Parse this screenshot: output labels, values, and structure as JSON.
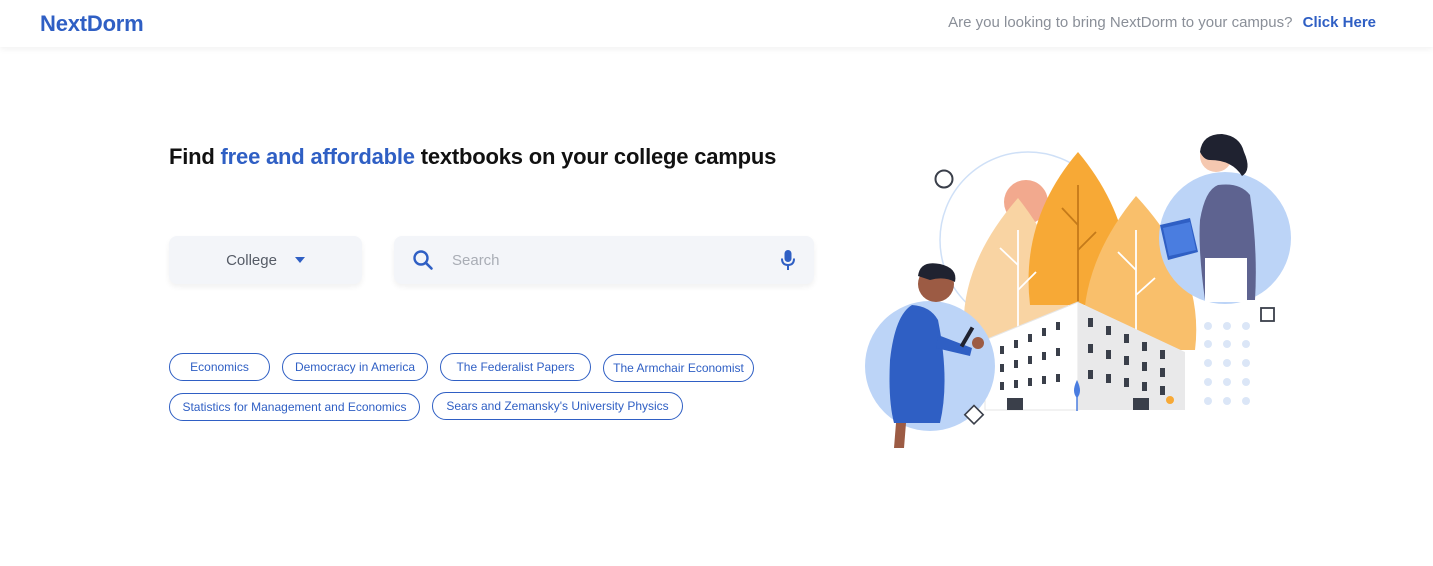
{
  "header": {
    "logo": "NextDorm",
    "promo_text": "Are you looking to bring NextDorm to your campus?",
    "promo_link": "Click Here"
  },
  "hero": {
    "headline_pre": "Find ",
    "headline_highlight": "free and affordable",
    "headline_post": " textbooks on your college campus"
  },
  "college_select": {
    "label": "College",
    "icon": "caret-down-icon"
  },
  "search": {
    "placeholder": "Search",
    "search_icon": "search-icon",
    "mic_icon": "microphone-icon"
  },
  "chips": [
    "Economics",
    "Democracy in America",
    "The Federalist Papers",
    "The Armchair Economist",
    "Statistics for Management and Economics",
    "Sears and Zemansky's University Physics"
  ],
  "colors": {
    "brand": "#2f5fc4",
    "muted": "#8a8f98",
    "field_bg": "#f3f5f9"
  }
}
